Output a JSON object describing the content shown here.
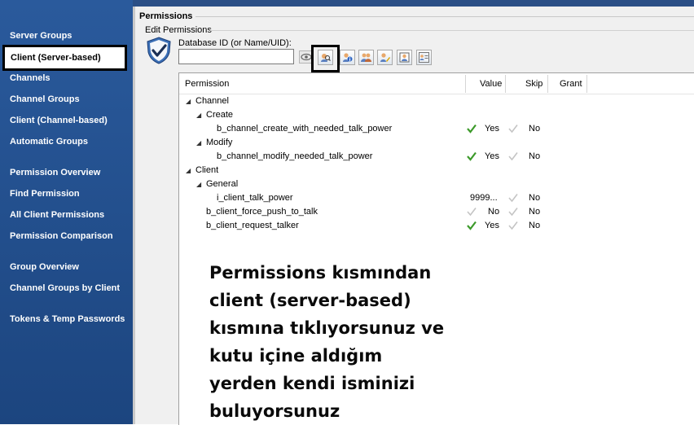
{
  "sidebar": {
    "items": [
      {
        "label": "Server Groups"
      },
      {
        "label": "Client (Server-based)"
      },
      {
        "label": "Channels"
      },
      {
        "label": "Channel Groups"
      },
      {
        "label": "Client (Channel-based)"
      },
      {
        "label": "Automatic Groups"
      },
      {
        "label": "Permission Overview"
      },
      {
        "label": "Find Permission"
      },
      {
        "label": "All Client Permissions"
      },
      {
        "label": "Permission Comparison"
      },
      {
        "label": "Group Overview"
      },
      {
        "label": "Channel Groups by Client"
      },
      {
        "label": "Tokens & Temp Passwords"
      }
    ],
    "selected_index": 1
  },
  "header": {
    "title": "Permissions",
    "subtitle": "Edit Permissions",
    "dbid_label": "Database ID (or Name/UID):",
    "dbid_value": ""
  },
  "toolbar": {
    "icons": [
      "eye-icon",
      "find-client-icon",
      "client-info-icon",
      "client-group-icon",
      "edit-client-icon",
      "client-card-icon",
      "client-list-icon"
    ]
  },
  "table": {
    "columns": {
      "permission": "Permission",
      "value": "Value",
      "skip": "Skip",
      "grant": "Grant"
    },
    "rows": [
      {
        "name": "Channel",
        "value": "",
        "skip": ""
      },
      {
        "name": "Create",
        "value": "",
        "skip": ""
      },
      {
        "name": "b_channel_create_with_needed_talk_power",
        "value": "Yes",
        "skip": "No"
      },
      {
        "name": "Modify",
        "value": "",
        "skip": ""
      },
      {
        "name": "b_channel_modify_needed_talk_power",
        "value": "Yes",
        "skip": "No"
      },
      {
        "name": "Client",
        "value": "",
        "skip": ""
      },
      {
        "name": "General",
        "value": "",
        "skip": ""
      },
      {
        "name": "i_client_talk_power",
        "value": "9999...",
        "skip": "No"
      },
      {
        "name": "b_client_force_push_to_talk",
        "value": "No",
        "skip": "No"
      },
      {
        "name": "b_client_request_talker",
        "value": "Yes",
        "skip": "No"
      }
    ]
  },
  "annotation": {
    "lines": [
      "Permissions kısmından",
      "client (server-based)",
      "kısmına tıklıyorsunuz ve",
      "kutu içine aldığım",
      "yerden kendi isminizi",
      "buluyorsunuz"
    ]
  },
  "colors": {
    "sidebar": "#2a5a9c",
    "check_green": "#3c9a2a",
    "highlight": "#000000"
  }
}
